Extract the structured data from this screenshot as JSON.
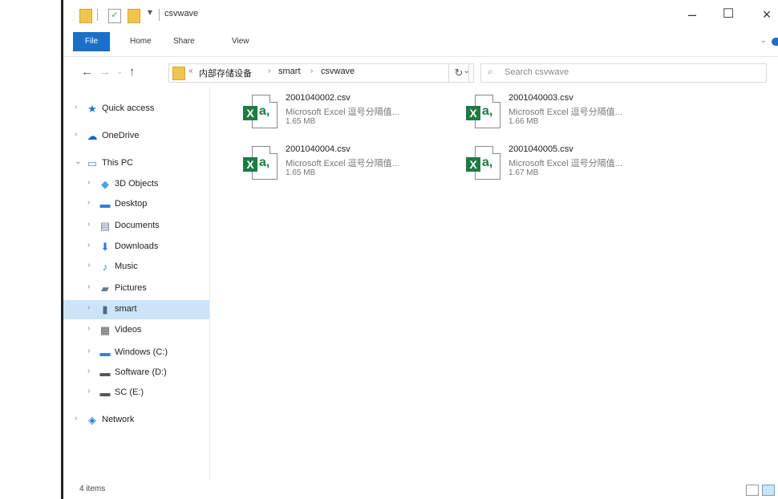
{
  "window": {
    "title": "csvwave",
    "controls": {
      "minimize": "–",
      "maximize": "☐",
      "close": "×"
    }
  },
  "quick_access_toolbar": {
    "dropdown": "▾"
  },
  "ribbon": {
    "tabs": [
      "File",
      "Home",
      "Share",
      "View"
    ],
    "expand_chevron": "⌄"
  },
  "address_bar": {
    "overflow": "«",
    "segments": [
      "内部存储设备",
      "smart",
      "csvwave"
    ],
    "separator": "›",
    "dropdown": "⌄",
    "refresh": "↻"
  },
  "search": {
    "placeholder": "Search csvwave"
  },
  "navigation": {
    "back": "←",
    "forward": "→",
    "recent": "⌄",
    "up": "↑",
    "items": [
      {
        "label": "Quick access",
        "icon": "star-icon",
        "glyph": "★",
        "color": "#1e74d2",
        "indent": 0,
        "chevron": "›"
      },
      {
        "label": "OneDrive",
        "icon": "cloud-icon",
        "glyph": "☁",
        "color": "#0b64c4",
        "indent": 0,
        "chevron": "›"
      },
      {
        "label": "This PC",
        "icon": "computer-icon",
        "glyph": "▭",
        "color": "#3d8fd8",
        "indent": 0,
        "chevron": "⌄"
      },
      {
        "label": "3D Objects",
        "icon": "cube-icon",
        "glyph": "◆",
        "color": "#4aa3e0",
        "indent": 1,
        "chevron": "›"
      },
      {
        "label": "Desktop",
        "icon": "desktop-icon",
        "glyph": "▬",
        "color": "#2b7fd4",
        "indent": 1,
        "chevron": "›"
      },
      {
        "label": "Documents",
        "icon": "document-icon",
        "glyph": "▤",
        "color": "#6b7f99",
        "indent": 1,
        "chevron": "›"
      },
      {
        "label": "Downloads",
        "icon": "download-icon",
        "glyph": "⬇",
        "color": "#2d7bd0",
        "indent": 1,
        "chevron": "›"
      },
      {
        "label": "Music",
        "icon": "music-icon",
        "glyph": "♪",
        "color": "#2d7bd0",
        "indent": 1,
        "chevron": "›"
      },
      {
        "label": "Pictures",
        "icon": "picture-icon",
        "glyph": "▰",
        "color": "#5e7b95",
        "indent": 1,
        "chevron": "›"
      },
      {
        "label": "smart",
        "icon": "device-icon",
        "glyph": "▮",
        "color": "#4a6a8a",
        "indent": 1,
        "chevron": "›",
        "selected": true
      },
      {
        "label": "Videos",
        "icon": "video-icon",
        "glyph": "▦",
        "color": "#555555",
        "indent": 1,
        "chevron": "›"
      },
      {
        "label": "Windows (C:)",
        "icon": "windows-drive-icon",
        "glyph": "▬",
        "color": "#3c7fc4",
        "indent": 1,
        "chevron": "›"
      },
      {
        "label": "Software (D:)",
        "icon": "drive-icon",
        "glyph": "▬",
        "color": "#555555",
        "indent": 1,
        "chevron": "›"
      },
      {
        "label": "SC (E:)",
        "icon": "drive-icon",
        "glyph": "▬",
        "color": "#555555",
        "indent": 1,
        "chevron": "›"
      },
      {
        "label": "Network",
        "icon": "network-icon",
        "glyph": "◈",
        "color": "#2d7bd0",
        "indent": 0,
        "chevron": "›"
      }
    ]
  },
  "files": [
    {
      "name": "2001040002.csv",
      "type": "Microsoft Excel 逗号分隔值...",
      "size": "1.65 MB"
    },
    {
      "name": "2001040003.csv",
      "type": "Microsoft Excel 逗号分隔值...",
      "size": "1.66 MB"
    },
    {
      "name": "2001040004.csv",
      "type": "Microsoft Excel 逗号分隔值...",
      "size": "1.65 MB"
    },
    {
      "name": "2001040005.csv",
      "type": "Microsoft Excel 逗号分隔值...",
      "size": "1.67 MB"
    }
  ],
  "file_icon": {
    "badge": "X",
    "letter": "a,"
  },
  "status_bar": {
    "count": "4 items"
  }
}
